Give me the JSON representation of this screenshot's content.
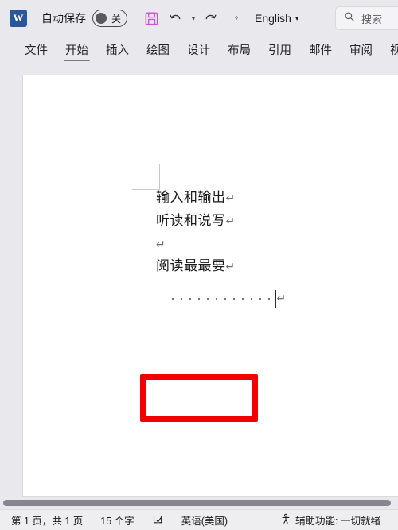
{
  "titlebar": {
    "app_icon_letter": "W",
    "app_icon_name": "word-app-icon",
    "autosave_label": "自动保存",
    "autosave_state": "关",
    "save_icon": "save-floppy-icon",
    "undo_icon": "undo-icon",
    "undo_dropdown_icon": "chevron-down-icon",
    "redo_icon": "redo-icon",
    "qat_more_icon": "qat-customize-icon",
    "language": "English",
    "language_dropdown_icon": "chevron-down-icon",
    "search_icon": "search-icon",
    "search_placeholder": "搜索"
  },
  "ribbon": {
    "active_tab": "开始",
    "tabs": [
      {
        "label": "文件"
      },
      {
        "label": "开始"
      },
      {
        "label": "插入"
      },
      {
        "label": "绘图"
      },
      {
        "label": "设计"
      },
      {
        "label": "布局"
      },
      {
        "label": "引用"
      },
      {
        "label": "邮件"
      },
      {
        "label": "审阅"
      },
      {
        "label": "视图"
      }
    ]
  },
  "document": {
    "paragraphs": [
      {
        "text": "输入和输出",
        "mark": "↵"
      },
      {
        "text": "听读和说写",
        "mark": "↵"
      },
      {
        "text": "",
        "mark": "↵"
      },
      {
        "text": "阅读最最要",
        "mark": "↵"
      }
    ],
    "leader_line": {
      "dot_count": 12,
      "mark": "↵",
      "caret_visible": true
    },
    "annotation": {
      "type": "red-rectangle",
      "color": "#f50000"
    }
  },
  "statusbar": {
    "page_info": "第 1 页，共 1 页",
    "word_count": "15 个字",
    "proofing_icon": "proofing-check-icon",
    "language": "英语(美国)",
    "accessibility_icon": "accessibility-icon",
    "accessibility": "辅助功能: 一切就绪"
  }
}
